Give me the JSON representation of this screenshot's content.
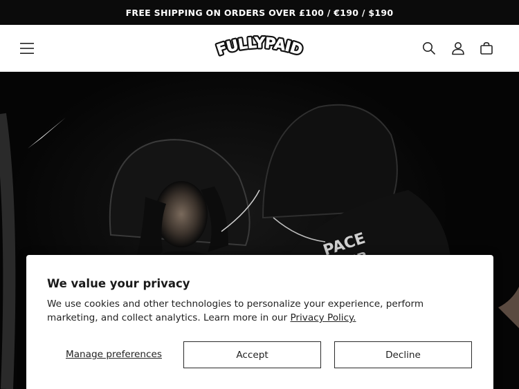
{
  "announcement": {
    "text": "FREE SHIPPING ON ORDERS OVER £100 / €190 / $190"
  },
  "header": {
    "logo_text": "FULLYPAID",
    "icons": [
      "menu-icon",
      "search-icon",
      "account-icon",
      "cart-icon"
    ]
  },
  "cookie_banner": {
    "title": "We value your privacy",
    "body": "We use cookies and other technologies to personalize your experience, perform marketing, and collect analytics. Learn more in our",
    "policy_link": "Privacy Policy.",
    "manage_label": "Manage preferences",
    "accept_label": "Accept",
    "decline_label": "Decline"
  },
  "colors": {
    "announcement_bg": "#0b0b0b",
    "header_bg": "#ffffff",
    "hero_bg": "#050505",
    "text": "#222222"
  }
}
